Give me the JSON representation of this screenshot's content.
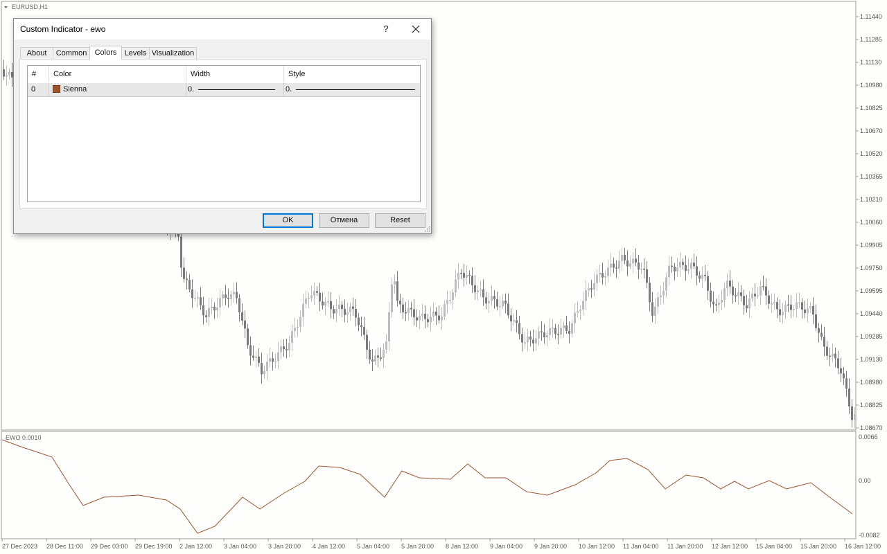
{
  "chart": {
    "symbol": "EURUSD,H1",
    "price_axis": [
      "1.11440",
      "1.11285",
      "1.11130",
      "1.10980",
      "1.10825",
      "1.10670",
      "1.10520",
      "1.10365",
      "1.10210",
      "1.10060",
      "1.09905",
      "1.09750",
      "1.09595",
      "1.09440",
      "1.09285",
      "1.09130",
      "1.08980",
      "1.08825",
      "1.08670"
    ],
    "time_axis": [
      "27 Dec 2023",
      "28 Dec 11:00",
      "29 Dec 03:00",
      "29 Dec 19:00",
      "2 Jan 12:00",
      "3 Jan 04:00",
      "3 Jan 20:00",
      "4 Jan 12:00",
      "5 Jan 04:00",
      "5 Jan 20:00",
      "8 Jan 12:00",
      "9 Jan 04:00",
      "9 Jan 20:00",
      "10 Jan 12:00",
      "11 Jan 04:00",
      "11 Jan 20:00",
      "12 Jan 12:00",
      "15 Jan 04:00",
      "15 Jan 20:00",
      "16 Jan 12:00"
    ],
    "indicator_label": "EWO 0.0010",
    "indicator_axis": [
      "0.0066",
      "0.00",
      "-0.0082"
    ],
    "indicator_color": "#a0522d"
  },
  "dialog": {
    "title": "Custom Indicator - ewo",
    "help_label": "?",
    "tabs": [
      "About",
      "Common",
      "Colors",
      "Levels",
      "Visualization"
    ],
    "active_tab": "Colors",
    "table": {
      "headers": [
        "#",
        "Color",
        "Width",
        "Style"
      ],
      "rows": [
        {
          "index": "0",
          "color_name": "Sienna",
          "color_hex": "#a0522d",
          "width": "0.",
          "style": "0."
        }
      ]
    },
    "buttons": {
      "ok": "OK",
      "cancel": "Отмена",
      "reset": "Reset"
    }
  }
}
